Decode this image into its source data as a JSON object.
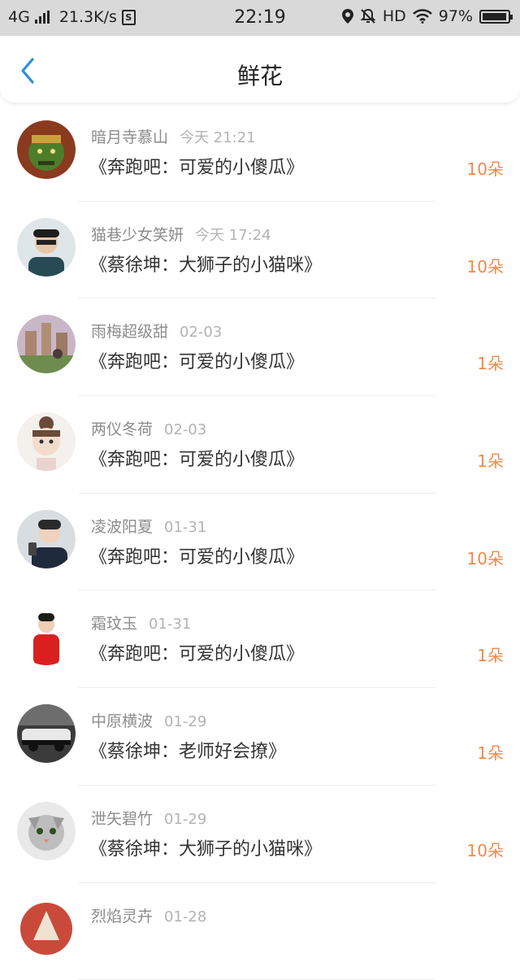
{
  "status_bar": {
    "network": "4G",
    "speed": "21.3K/s",
    "s_label": "S",
    "time": "22:19",
    "hd": "HD",
    "battery_percent": "97%",
    "battery_level": 0.97
  },
  "header": {
    "title": "鲜花",
    "back_icon": "chevron-left-icon",
    "accent_color": "#2b8ee8"
  },
  "gift_list": [
    {
      "name": "暗月寺慕山",
      "time": "今天 21:21",
      "song": "《奔跑吧：可爱的小傻瓜》",
      "count": "10朵"
    },
    {
      "name": "猫巷少女笑妍",
      "time": "今天 17:24",
      "song": "《蔡徐坤：大狮子的小猫咪》",
      "count": "10朵"
    },
    {
      "name": "雨梅超级甜",
      "time": "02-03",
      "song": "《奔跑吧：可爱的小傻瓜》",
      "count": "1朵"
    },
    {
      "name": "两仪冬荷",
      "time": "02-03",
      "song": "《奔跑吧：可爱的小傻瓜》",
      "count": "1朵"
    },
    {
      "name": "凌波阳夏",
      "time": "01-31",
      "song": "《奔跑吧：可爱的小傻瓜》",
      "count": "10朵"
    },
    {
      "name": "霜玟玉",
      "time": "01-31",
      "song": "《奔跑吧：可爱的小傻瓜》",
      "count": "1朵"
    },
    {
      "name": "中原横波",
      "time": "01-29",
      "song": "《蔡徐坤：老师好会撩》",
      "count": "1朵"
    },
    {
      "name": "泄矢碧竹",
      "time": "01-29",
      "song": "《蔡徐坤：大狮子的小猫咪》",
      "count": "10朵"
    },
    {
      "name": "烈焰灵卉",
      "time": "01-28",
      "song": "",
      "count": ""
    }
  ],
  "colors": {
    "count_color": "#f08a4b",
    "name_color": "#8c8c8c"
  }
}
